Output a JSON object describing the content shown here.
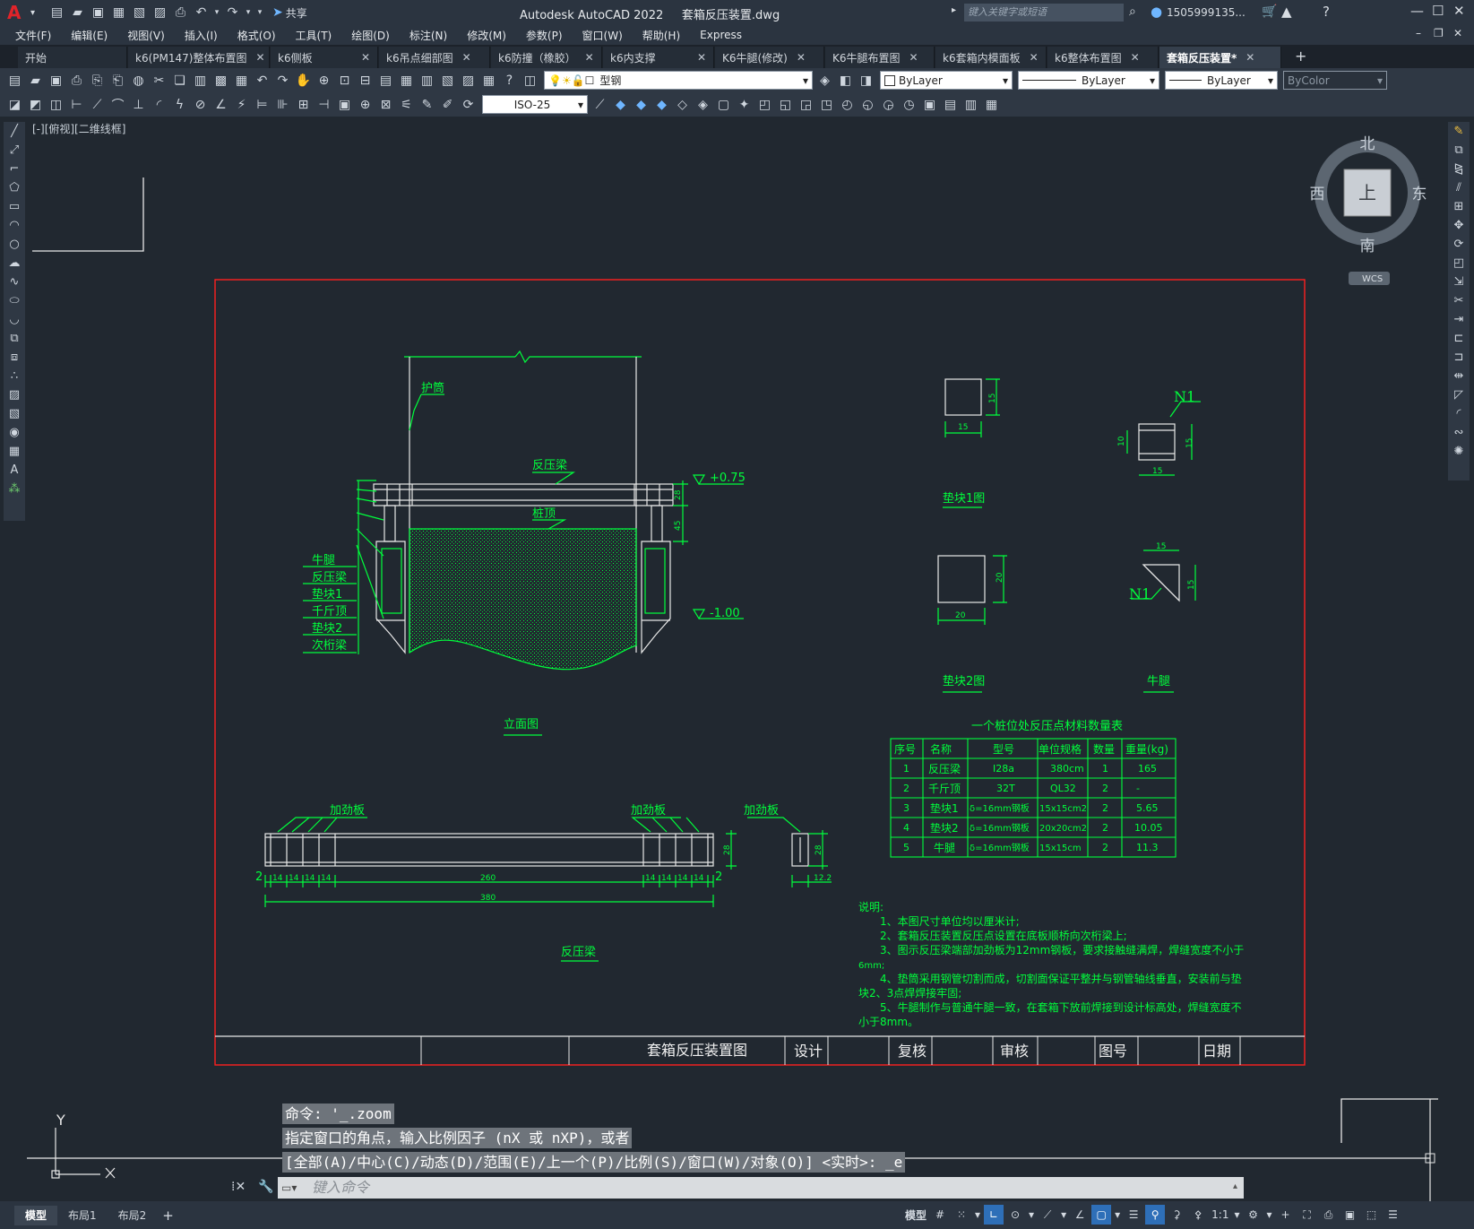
{
  "title": {
    "app_name": "Autodesk AutoCAD 2022",
    "file_name": "套箱反压装置.dwg",
    "share_label": "共享",
    "search_placeholder": "键入关键字或短语",
    "user": "1505999135..."
  },
  "menu": [
    "文件(F)",
    "编辑(E)",
    "视图(V)",
    "插入(I)",
    "格式(O)",
    "工具(T)",
    "绘图(D)",
    "标注(N)",
    "修改(M)",
    "参数(P)",
    "窗口(W)",
    "帮助(H)",
    "Express"
  ],
  "tabs": [
    {
      "label": "开始",
      "closable": false
    },
    {
      "label": "k6(PM147)整体布置图",
      "closable": true
    },
    {
      "label": "k6侧板",
      "closable": true
    },
    {
      "label": "k6吊点细部图",
      "closable": true
    },
    {
      "label": "k6防撞（橡胶）",
      "closable": true
    },
    {
      "label": "k6内支撑",
      "closable": true
    },
    {
      "label": "K6牛腿(修改)",
      "closable": true
    },
    {
      "label": "K6牛腿布置图",
      "closable": true
    },
    {
      "label": "k6套箱内模面板",
      "closable": true
    },
    {
      "label": "k6整体布置图",
      "closable": true
    },
    {
      "label": "套箱反压装置*",
      "closable": true,
      "active": true
    }
  ],
  "toolbar": {
    "layer": "型钢",
    "color": "ByLayer",
    "linetype": "ByLayer",
    "lineweight": "ByLayer",
    "plotstyle": "ByColor",
    "dimstyle": "ISO-25"
  },
  "viewport": {
    "label": "[-][俯视][二维线框]",
    "compass_n": "北",
    "compass_s": "南",
    "compass_e": "东",
    "compass_w": "西",
    "cube_face": "上",
    "wcs": "WCS"
  },
  "drawing": {
    "labels": {
      "hutong": "护筒",
      "fanyaliang": "反压梁",
      "zhuangding": "桩顶",
      "elev_top": "+0.75",
      "elev_bot": "-1.00",
      "dim28": "28",
      "dim45": "45",
      "left_callouts": [
        "牛腿",
        "反压梁",
        "垫块1",
        "千斤顶",
        "垫块2",
        "次桁梁"
      ],
      "lim_title": "立面图",
      "pad1": "垫块1图",
      "pad1_w": "15",
      "pad1_h": "15",
      "pad2": "垫块2图",
      "pad2_w": "20",
      "pad2_h": "20",
      "bracket": "牛腿",
      "n1": "N1",
      "n1a_w": "15",
      "n1a_h": "15",
      "n1a_l": "10",
      "n1b_w": "15",
      "n1b_h": "15",
      "beam_title": "反压梁",
      "jiajinban": "加劲板",
      "beam_d14": "14",
      "beam_d2": "2",
      "beam_260": "260",
      "beam_380": "380",
      "beam_28": "28",
      "side_28": "28",
      "side_122": "12.2"
    },
    "table": {
      "title": "一个桩位处反压点材料数量表",
      "headers": [
        "序号",
        "名称",
        "型号",
        "单位规格",
        "数量",
        "重量(kg)"
      ],
      "rows": [
        [
          "1",
          "反压梁",
          "I28a",
          "380cm",
          "1",
          "165"
        ],
        [
          "2",
          "千斤顶",
          "32T",
          "QL32",
          "2",
          "-"
        ],
        [
          "3",
          "垫块1",
          "δ=16mm钢板",
          "15x15cm2",
          "2",
          "5.65"
        ],
        [
          "4",
          "垫块2",
          "δ=16mm钢板",
          "20x20cm2",
          "2",
          "10.05"
        ],
        [
          "5",
          "牛腿",
          "δ=16mm钢板",
          "15x15cm",
          "2",
          "11.3"
        ]
      ]
    },
    "notes": [
      "说明:",
      "1、本图尺寸单位均以厘米计;",
      "2、套箱反压装置反压点设置在底板顺桥向次桁梁上;",
      "3、图示反压梁端部加劲板为12mm钢板，要求接触缝满焊，焊缝宽度不小于",
      "6mm;",
      "4、垫筒采用钢管切割而成，切割面保证平整并与钢管轴线垂直，安装前与垫",
      "块2、3点焊焊接牢固;",
      "5、牛腿制作与普通牛腿一致，在套箱下放前焊接到设计标高处，焊缝宽度不",
      "小于8mm。"
    ],
    "titleblock": [
      "套箱反压装置图",
      "设计",
      "复核",
      "审核",
      "图号",
      "日期"
    ]
  },
  "command": {
    "line1": "命令: '_.zoom",
    "line2": "指定窗口的角点，输入比例因子 (nX 或 nXP)，或者",
    "line3": "[全部(A)/中心(C)/动态(D)/范围(E)/上一个(P)/比例(S)/窗口(W)/对象(O)] <实时>: _e",
    "placeholder": "键入命令"
  },
  "status": {
    "layouts": [
      "模型",
      "布局1",
      "布局2"
    ],
    "model": "模型",
    "scale": "1:1"
  },
  "ucs": {
    "y": "Y"
  },
  "colors": {
    "drawing_green": "#00ff3c",
    "frame_red": "#ff2020",
    "bg": "#212830"
  }
}
